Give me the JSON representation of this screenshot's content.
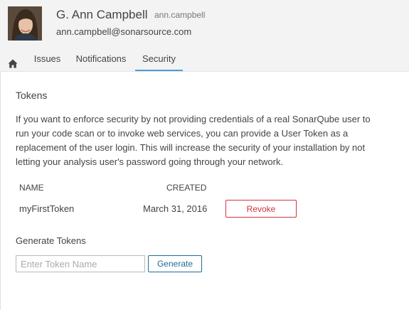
{
  "user": {
    "name": "G. Ann Campbell",
    "login": "ann.campbell",
    "email": "ann.campbell@sonarsource.com",
    "avatar_icon": "user-avatar"
  },
  "tabs": {
    "home_icon": "home-icon",
    "items": [
      {
        "label": "Issues"
      },
      {
        "label": "Notifications"
      },
      {
        "label": "Security",
        "active": true
      }
    ]
  },
  "tokens": {
    "title": "Tokens",
    "description": "If you want to enforce security by not providing credentials of a real SonarQube user to run your code scan or to invoke web services, you can provide a User Token as a replacement of the user login. This will increase the security of your installation by not letting your analysis user's password going through your network.",
    "columns": {
      "name": "NAME",
      "created": "CREATED"
    },
    "rows": [
      {
        "name": "myFirstToken",
        "created": "March 31, 2016",
        "action": "Revoke"
      }
    ]
  },
  "generate": {
    "title": "Generate Tokens",
    "input_placeholder": "Enter Token Name",
    "input_value": "",
    "button_label": "Generate"
  },
  "colors": {
    "accent": "#4b9fd5",
    "danger": "#d4333f",
    "primary_button": "#236a97",
    "header_bg": "#f3f3f3"
  }
}
